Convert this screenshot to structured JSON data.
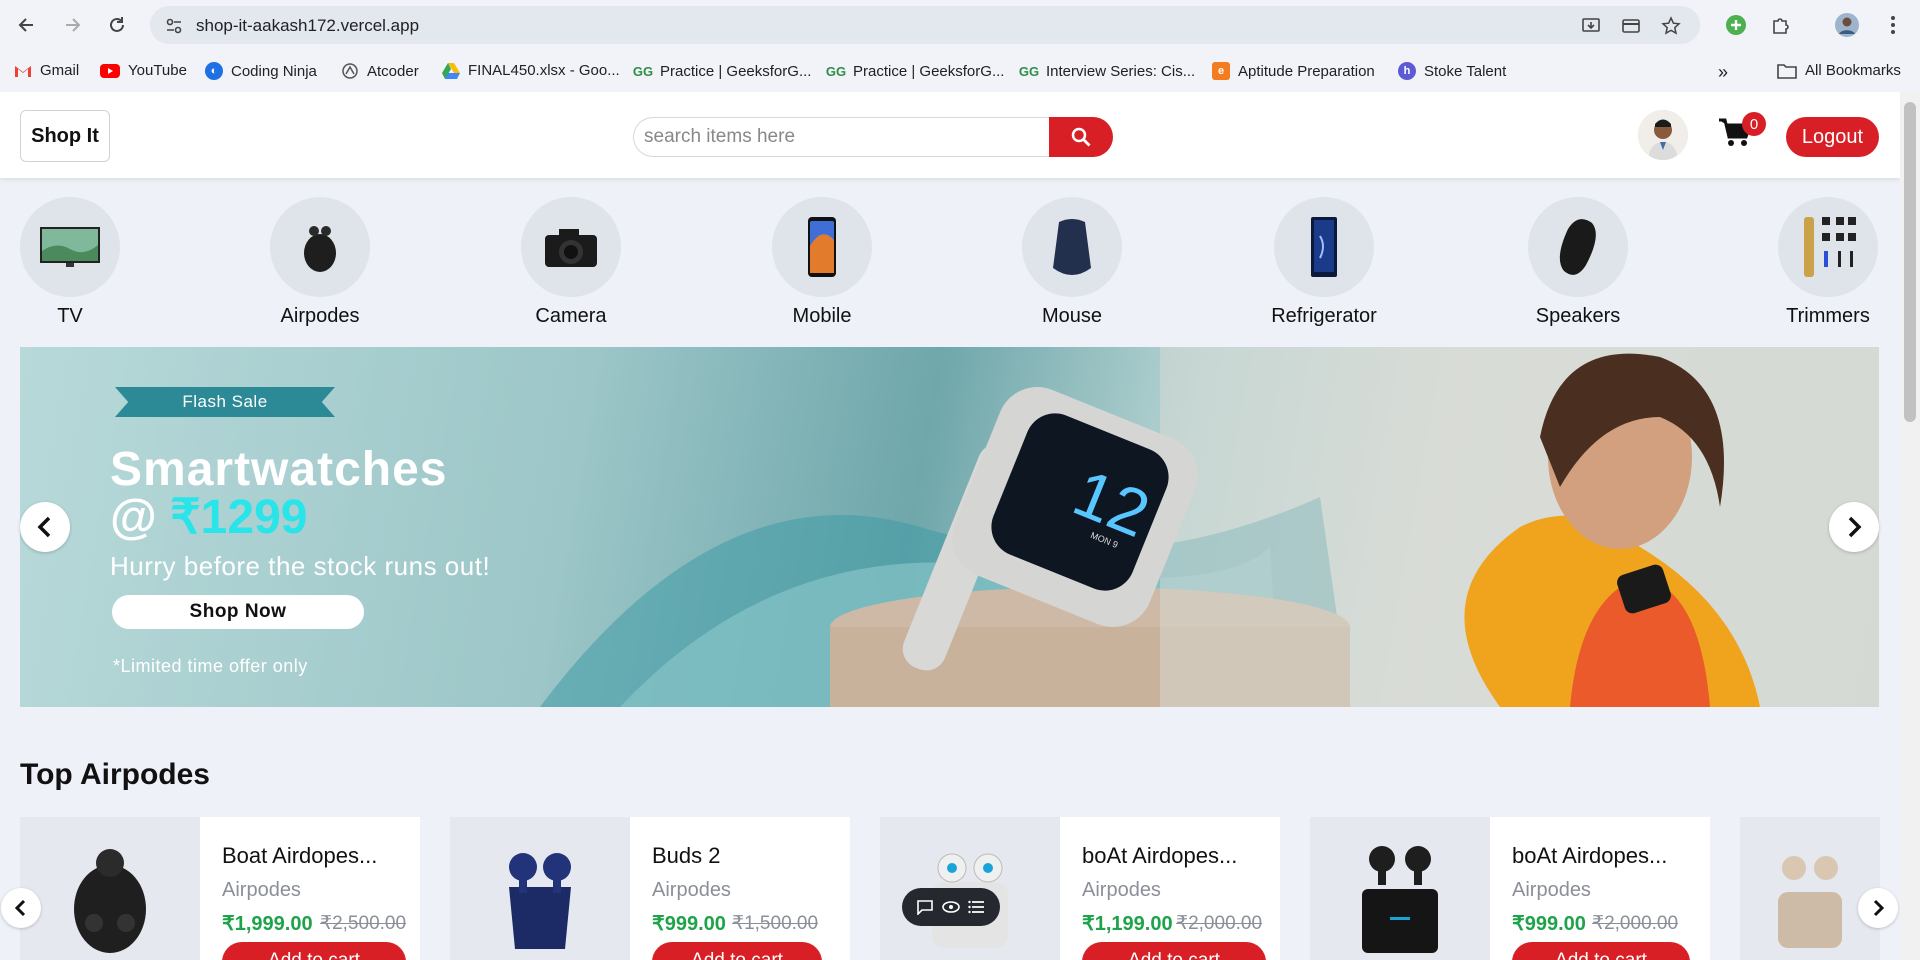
{
  "browser": {
    "url": "shop-it-aakash172.vercel.app",
    "bookmarks": [
      {
        "label": "Gmail",
        "icon": "gmail-icon",
        "color": "#ea4335"
      },
      {
        "label": "YouTube",
        "icon": "youtube-icon",
        "color": "#ff0000"
      },
      {
        "label": "Coding Ninja",
        "icon": "coding-ninja-icon",
        "color": "#1f6fe5"
      },
      {
        "label": "Atcoder",
        "icon": "atcoder-icon",
        "color": "#555555"
      },
      {
        "label": "FINAL450.xlsx - Goo...",
        "icon": "google-drive-icon",
        "color": "#34a853"
      },
      {
        "label": "Practice | GeeksforG...",
        "icon": "geeksforgeeks-icon",
        "color": "#2f8d46"
      },
      {
        "label": "Practice | GeeksforG...",
        "icon": "geeksforgeeks-icon",
        "color": "#2f8d46"
      },
      {
        "label": "Interview Series: Cis...",
        "icon": "geeksforgeeks-icon",
        "color": "#2f8d46"
      },
      {
        "label": "Aptitude Preparation",
        "icon": "aptitude-icon",
        "color": "#f47c20"
      },
      {
        "label": "Stoke Talent",
        "icon": "stoke-talent-icon",
        "color": "#5b5bd6"
      }
    ],
    "all_bookmarks": "All Bookmarks"
  },
  "header": {
    "logo": "Shop It",
    "search_placeholder": "search items here",
    "cart_count": "0",
    "logout": "Logout"
  },
  "categories": [
    {
      "label": "TV",
      "icon": "tv-icon"
    },
    {
      "label": "Airpodes",
      "icon": "earbuds-icon"
    },
    {
      "label": "Camera",
      "icon": "camera-icon"
    },
    {
      "label": "Mobile",
      "icon": "mobile-icon"
    },
    {
      "label": "Mouse",
      "icon": "mouse-icon"
    },
    {
      "label": "Refrigerator",
      "icon": "refrigerator-icon"
    },
    {
      "label": "Speakers",
      "icon": "speaker-icon"
    },
    {
      "label": "Trimmers",
      "icon": "trimmer-icon"
    }
  ],
  "banner": {
    "ribbon": "Flash Sale",
    "title": "Smartwatches",
    "price_prefix": "@ ",
    "price": "₹1299",
    "subtitle": "Hurry before the stock runs out!",
    "cta": "Shop Now",
    "note": "*Limited time offer only",
    "watch_face_text": "12",
    "watch_day": "MON 9"
  },
  "products_section": {
    "title": "Top Airpodes",
    "add_label": "Add to cart",
    "items": [
      {
        "name": "Boat Airdopes...",
        "category": "Airpodes",
        "price": "₹1,999.00",
        "mrp": "₹2,500.00"
      },
      {
        "name": "Buds 2",
        "category": "Airpodes",
        "price": "₹999.00",
        "mrp": "₹1,500.00"
      },
      {
        "name": "boAt Airdopes...",
        "category": "Airpodes",
        "price": "₹1,199.00",
        "mrp": "₹2,000.00"
      },
      {
        "name": "boAt Airdopes...",
        "category": "Airpodes",
        "price": "₹999.00",
        "mrp": "₹2,000.00"
      }
    ]
  }
}
